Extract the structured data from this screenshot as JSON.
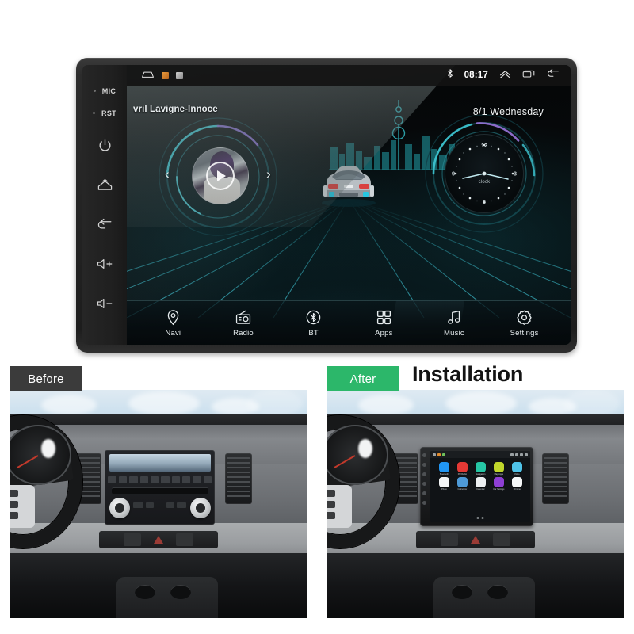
{
  "device": {
    "hardkeys": [
      {
        "name": "mic",
        "label": "MIC",
        "type": "text-dot"
      },
      {
        "name": "rst",
        "label": "RST",
        "type": "text-dot"
      },
      {
        "name": "power",
        "label": "",
        "type": "icon-power"
      },
      {
        "name": "home",
        "label": "",
        "type": "icon-home"
      },
      {
        "name": "back",
        "label": "",
        "type": "icon-back"
      },
      {
        "name": "volume-up",
        "label": "+",
        "type": "icon-vol"
      },
      {
        "name": "volume-down",
        "label": "−",
        "type": "icon-vol"
      }
    ]
  },
  "statusbar": {
    "home_icon": "home-icon",
    "notification_icons": [
      "image-notification-icon",
      "screenshot-notification-icon"
    ],
    "bluetooth_icon": "bluetooth-icon",
    "time": "08:17",
    "expand_icon": "chevron-up-icon",
    "recents_icon": "recents-icon",
    "back_icon": "back-arrow-icon"
  },
  "home": {
    "track_title": "vril Lavigne-Innoce",
    "date": "8/1  Wednesday",
    "player": {
      "prev_label": "‹",
      "next_label": "›",
      "play_icon": "play-icon",
      "album_art": "album-art"
    },
    "clock": {
      "label": "clock",
      "numerals": [
        "12",
        "3",
        "6",
        "9"
      ]
    },
    "nav": [
      {
        "label": "Navi",
        "icon": "location-pin-icon",
        "active": false
      },
      {
        "label": "Radio",
        "icon": "radio-icon",
        "active": false
      },
      {
        "label": "BT",
        "icon": "bluetooth-icon",
        "active": false
      },
      {
        "label": "Apps",
        "icon": "grid-apps-icon",
        "active": true
      },
      {
        "label": "Music",
        "icon": "music-note-icon",
        "active": false
      },
      {
        "label": "Settings",
        "icon": "gear-icon",
        "active": false
      }
    ]
  },
  "compare": {
    "before_label": "Before",
    "after_label": "After",
    "title": "Installation",
    "before_accent": "#3b3b3b",
    "after_accent": "#2cb76a",
    "installed_apps": [
      {
        "label": "Bluetooth",
        "color": "#2196f3"
      },
      {
        "label": "FM Radio",
        "color": "#e53935"
      },
      {
        "label": "Navigation",
        "color": "#26c6a5"
      },
      {
        "label": "Map Apps",
        "color": "#c0d62b"
      },
      {
        "label": "Video",
        "color": "#4fc3e8"
      },
      {
        "label": "Photo",
        "color": "#f2f4f5"
      },
      {
        "label": "Calculator",
        "color": "#4e9ad8"
      },
      {
        "label": "Calendar",
        "color": "#eceff1"
      },
      {
        "label": "Car Settings",
        "color": "#8e3fd4"
      },
      {
        "label": "Chrome",
        "color": "#f5f7f8"
      }
    ]
  }
}
